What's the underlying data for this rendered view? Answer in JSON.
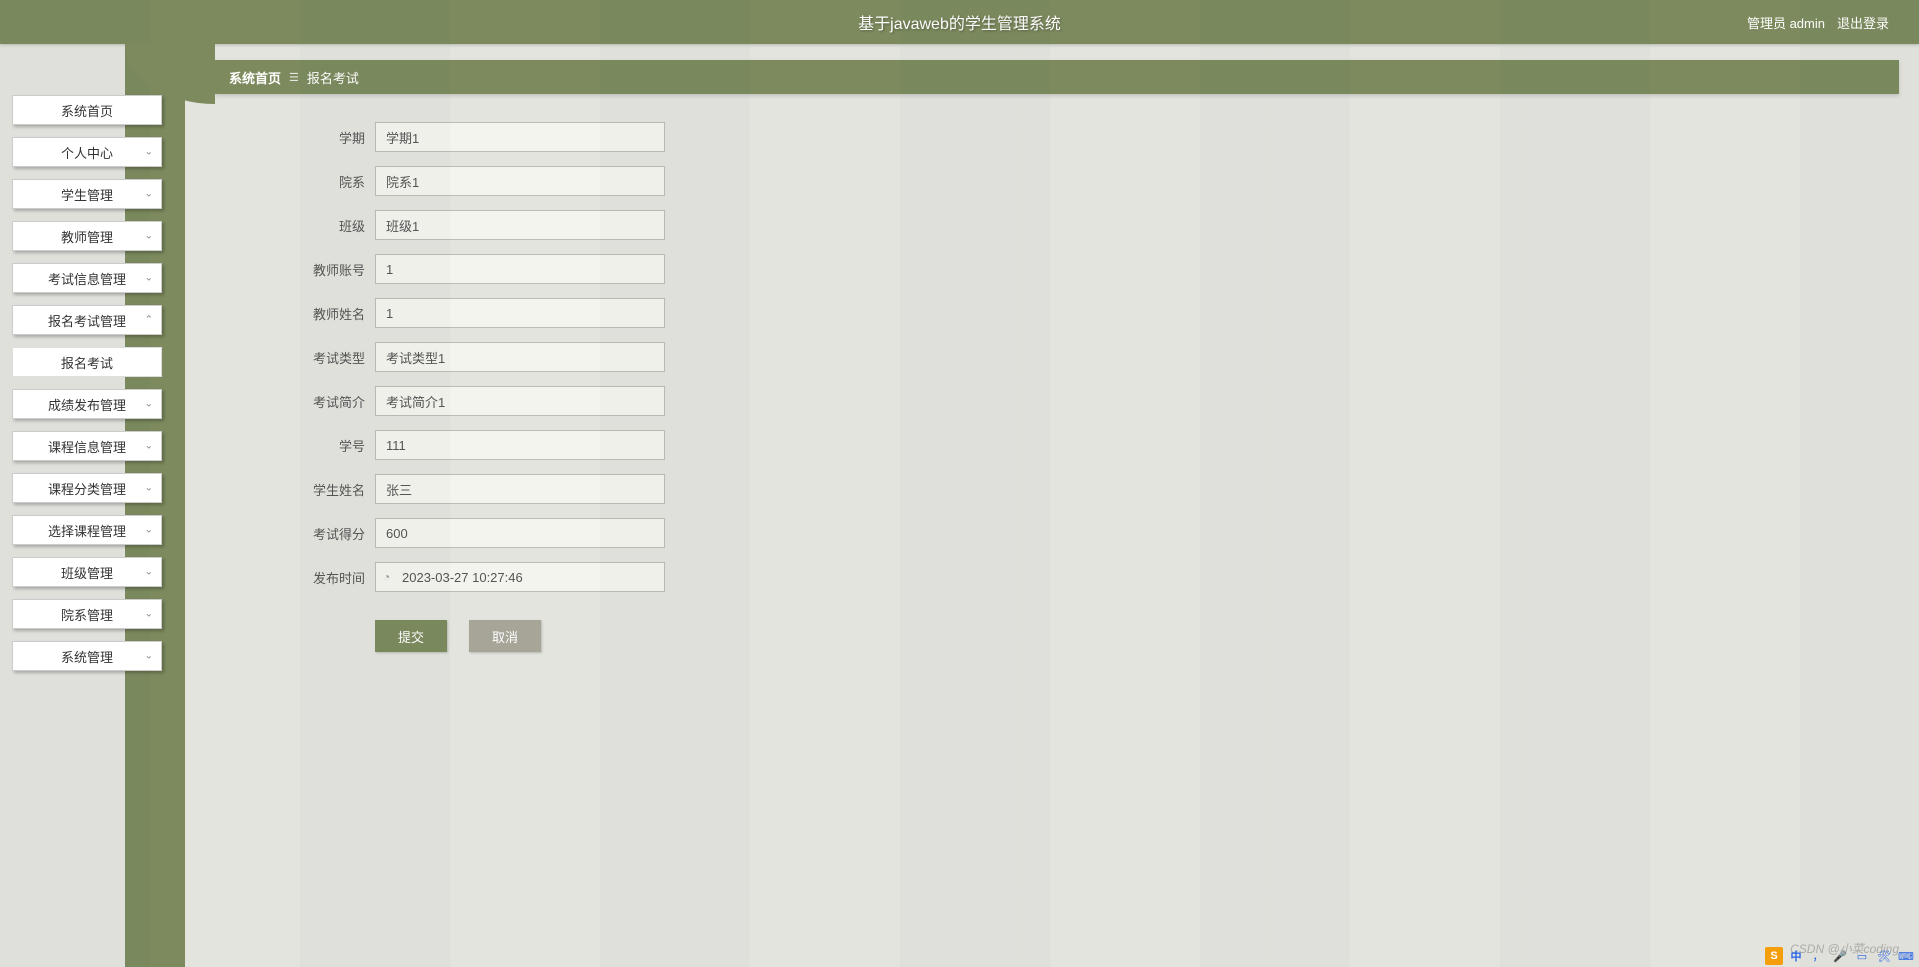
{
  "header": {
    "title": "基于javaweb的学生管理系统",
    "user_label": "管理员 admin",
    "logout_label": "退出登录"
  },
  "sidebar": {
    "items": [
      {
        "label": "系统首页",
        "expandable": false
      },
      {
        "label": "个人中心",
        "expandable": true
      },
      {
        "label": "学生管理",
        "expandable": true
      },
      {
        "label": "教师管理",
        "expandable": true
      },
      {
        "label": "考试信息管理",
        "expandable": true
      },
      {
        "label": "报名考试管理",
        "expandable": true,
        "expanded": true
      },
      {
        "label": "报名考试",
        "expandable": false,
        "active": true
      },
      {
        "label": "成绩发布管理",
        "expandable": true
      },
      {
        "label": "课程信息管理",
        "expandable": true
      },
      {
        "label": "课程分类管理",
        "expandable": true
      },
      {
        "label": "选择课程管理",
        "expandable": true
      },
      {
        "label": "班级管理",
        "expandable": true
      },
      {
        "label": "院系管理",
        "expandable": true
      },
      {
        "label": "系统管理",
        "expandable": true
      }
    ]
  },
  "breadcrumb": {
    "home": "系统首页",
    "sep": "☰",
    "current": "报名考试"
  },
  "form": {
    "fields": [
      {
        "key": "semester",
        "label": "学期",
        "value": "学期1"
      },
      {
        "key": "department",
        "label": "院系",
        "value": "院系1"
      },
      {
        "key": "class",
        "label": "班级",
        "value": "班级1"
      },
      {
        "key": "teacher_acct",
        "label": "教师账号",
        "value": "1"
      },
      {
        "key": "teacher_name",
        "label": "教师姓名",
        "value": "1"
      },
      {
        "key": "exam_type",
        "label": "考试类型",
        "value": "考试类型1"
      },
      {
        "key": "exam_intro",
        "label": "考试简介",
        "value": "考试简介1"
      },
      {
        "key": "student_id",
        "label": "学号",
        "value": "111"
      },
      {
        "key": "student_name",
        "label": "学生姓名",
        "value": "张三"
      },
      {
        "key": "exam_score",
        "label": "考试得分",
        "value": "600"
      },
      {
        "key": "publish_time",
        "label": "发布时间",
        "value": "2023-03-27 10:27:46",
        "type": "datetime"
      }
    ],
    "submit_label": "提交",
    "cancel_label": "取消"
  },
  "watermark": "CSDN @小菜coding",
  "tray": {
    "s": "S",
    "cn": "中",
    "space": "•"
  }
}
